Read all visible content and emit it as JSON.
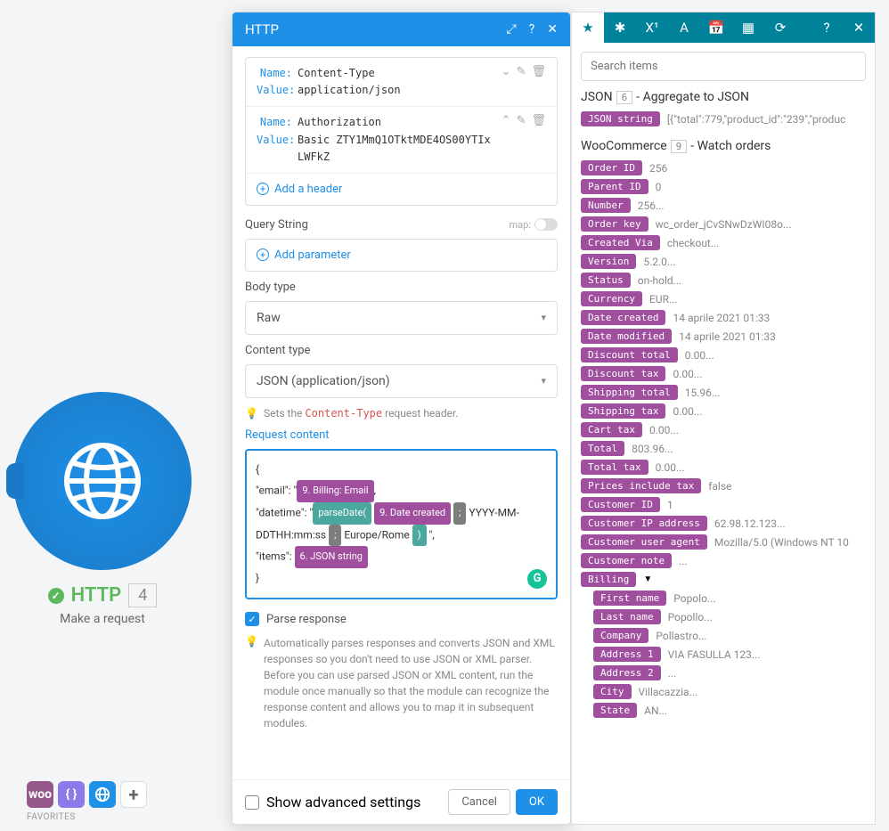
{
  "node": {
    "label": "HTTP",
    "badge": "4",
    "subtitle": "Make a request"
  },
  "favorites": {
    "label": "FAVORITES"
  },
  "modal": {
    "title": "HTTP",
    "headers": [
      {
        "name": "Content-Type",
        "value": "application/json"
      },
      {
        "name": "Authorization",
        "value": "Basic ZTY1MmQ1OTktMDE4OS00YTIxLWFkZ"
      }
    ],
    "add_header": "Add a header",
    "query_string_label": "Query String",
    "map_label": "map:",
    "add_parameter": "Add parameter",
    "body_type_label": "Body type",
    "body_type_value": "Raw",
    "content_type_label": "Content type",
    "content_type_value": "JSON (application/json)",
    "ct_hint_pre": "Sets the",
    "ct_hint_code": "Content-Type",
    "ct_hint_post": "request header.",
    "request_content_label": "Request content",
    "rc": {
      "l1": "{",
      "l2a": "\"email\": \"",
      "l2_pill": "9. Billing: Email",
      "l2b": ",",
      "l3a": "\"datetime\": \"",
      "l3_fn": "parseDate(",
      "l3_pill": "9. Date created",
      "l3_sep": ";",
      "l3b": "YYYY-MM-DDTHH:mm:ss",
      "l3_sep2": ";",
      "l3_tz": "Europe/Rome",
      "l3_close": ")",
      "l3_end": "\",",
      "l4a": "\"items\": ",
      "l4_pill": "6. JSON string",
      "l5": "}"
    },
    "parse_label": "Parse response",
    "parse_hint": "Automatically parses responses and converts JSON and XML responses so you don't need to use JSON or XML parser. Before you can use parsed JSON or XML content, run the module once manually so that the module can recognize the response content and allows you to map it in subsequent modules.",
    "advanced_label": "Show advanced settings",
    "cancel": "Cancel",
    "ok": "OK"
  },
  "panel": {
    "search_placeholder": "Search items",
    "json_section": {
      "prefix": "JSON",
      "num": "6",
      "suffix": "- Aggregate to JSON"
    },
    "json_var": {
      "name": "JSON string",
      "val": "[{\"total\":779,\"product_id\":\"239\",\"produc"
    },
    "woo_section": {
      "prefix": "WooCommerce",
      "num": "9",
      "suffix": "- Watch orders"
    },
    "vars": [
      {
        "name": "Order ID",
        "val": "256"
      },
      {
        "name": "Parent ID",
        "val": "0"
      },
      {
        "name": "Number",
        "val": "256..."
      },
      {
        "name": "Order key",
        "val": "wc_order_jCvSNwDzWI08o..."
      },
      {
        "name": "Created Via",
        "val": "checkout..."
      },
      {
        "name": "Version",
        "val": "5.2.0..."
      },
      {
        "name": "Status",
        "val": "on-hold..."
      },
      {
        "name": "Currency",
        "val": "EUR..."
      },
      {
        "name": "Date created",
        "val": "14 aprile 2021 01:33"
      },
      {
        "name": "Date modified",
        "val": "14 aprile 2021 01:33"
      },
      {
        "name": "Discount total",
        "val": "0.00..."
      },
      {
        "name": "Discount tax",
        "val": "0.00..."
      },
      {
        "name": "Shipping total",
        "val": "15.96..."
      },
      {
        "name": "Shipping tax",
        "val": "0.00..."
      },
      {
        "name": "Cart tax",
        "val": "0.00..."
      },
      {
        "name": "Total",
        "val": "803.96..."
      },
      {
        "name": "Total tax",
        "val": "0.00..."
      },
      {
        "name": "Prices include tax",
        "val": "false"
      },
      {
        "name": "Customer ID",
        "val": "1"
      },
      {
        "name": "Customer IP address",
        "val": "62.98.12.123..."
      },
      {
        "name": "Customer user agent",
        "val": "Mozilla/5.0 (Windows NT 10"
      },
      {
        "name": "Customer note",
        "val": "..."
      }
    ],
    "billing_label": "Billing",
    "billing_vars": [
      {
        "name": "First name",
        "val": "Popolo..."
      },
      {
        "name": "Last name",
        "val": "Popollo..."
      },
      {
        "name": "Company",
        "val": "Pollastro..."
      },
      {
        "name": "Address 1",
        "val": "VIA FASULLA 123..."
      },
      {
        "name": "Address 2",
        "val": "..."
      },
      {
        "name": "City",
        "val": "Villacazzia..."
      },
      {
        "name": "State",
        "val": "AN..."
      }
    ]
  }
}
